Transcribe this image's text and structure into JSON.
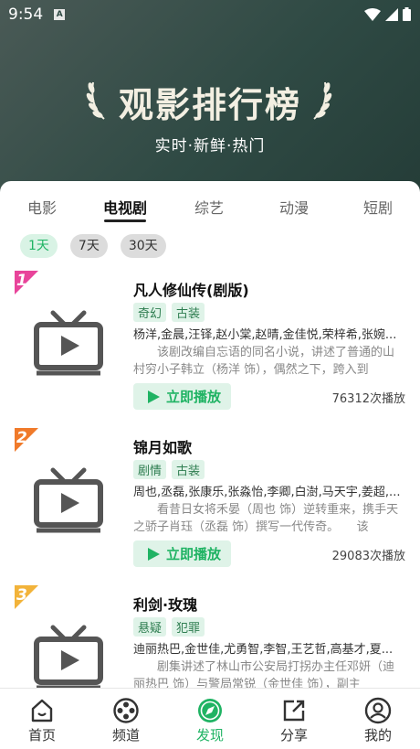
{
  "status_bar": {
    "time": "9:54",
    "badge": "A"
  },
  "hero": {
    "title": "观影排行榜",
    "subtitle": "实时·新鲜·热门"
  },
  "category_tabs": [
    "电影",
    "电视剧",
    "综艺",
    "动漫",
    "短剧"
  ],
  "active_tab": "电视剧",
  "time_filters": [
    "1天",
    "7天",
    "30天"
  ],
  "active_filter": "1天",
  "items": [
    {
      "rank": "1",
      "title": "凡人修仙传(剧版)",
      "tags": [
        "奇幻",
        "古装"
      ],
      "cast": "杨洋,金晨,汪铎,赵小棠,赵晴,金佳悦,荣梓希,张婉...",
      "desc": "该剧改编自忘语的同名小说，讲述了普通的山村穷小子韩立（杨洋 饰），偶然之下，跨入到",
      "play_label": "立即播放",
      "plays": "76312次播放",
      "badge_color": "#e8449a"
    },
    {
      "rank": "2",
      "title": "锦月如歌",
      "tags": [
        "剧情",
        "古装"
      ],
      "cast": "周也,丞磊,张康乐,张淼怡,李卿,白澍,马天宇,姜超,...",
      "desc": "看昔日女将禾晏（周也 饰）逆转重来，携手天之骄子肖珏（丞磊 饰）撰写一代传奇。　　该",
      "play_label": "立即播放",
      "plays": "29083次播放",
      "badge_color": "#f07a2a"
    },
    {
      "rank": "3",
      "title": "利剑·玫瑰",
      "tags": [
        "悬疑",
        "犯罪"
      ],
      "cast": "迪丽热巴,金世佳,尤勇智,李智,王艺哲,高基才,夏...",
      "desc": "剧集讲述了林山市公安局打拐办主任邓妍（迪丽热巴 饰）与警局常锐（金世佳 饰），副主",
      "play_label": "立即播放",
      "plays": "",
      "badge_color": "#f2b33a"
    }
  ],
  "bottom_nav": [
    "首页",
    "频道",
    "发现",
    "分享",
    "我的"
  ],
  "active_nav": "发现",
  "colors": {
    "accent": "#1fb363",
    "hero_bg": "#2f4a44"
  }
}
